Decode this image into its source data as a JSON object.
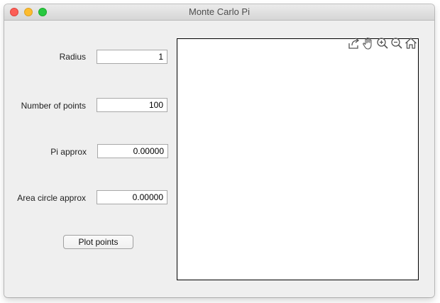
{
  "window": {
    "title": "Monte Carlo Pi"
  },
  "form": {
    "radius_label": "Radius",
    "radius_value": "1",
    "points_label": "Number of points",
    "points_value": "100",
    "pi_label": "Pi approx",
    "pi_value": "0.00000",
    "area_label": "Area circle approx",
    "area_value": "0.00000",
    "plot_button": "Plot points"
  },
  "axes_toolbar": {
    "icons": [
      "export-icon",
      "pan-icon",
      "zoom-in-icon",
      "zoom-out-icon",
      "home-icon"
    ]
  }
}
